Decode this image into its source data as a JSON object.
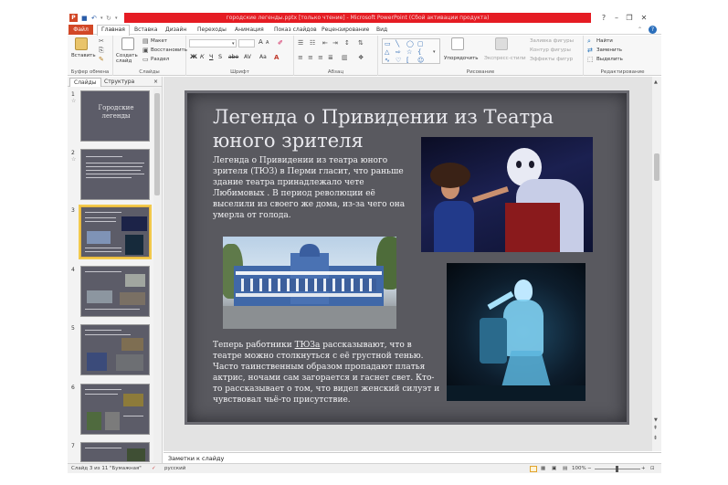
{
  "window": {
    "title": "городские легенды.pptx [только чтение] - Microsoft PowerPoint (Сбой активации продукта)",
    "app_letter": "P",
    "title_color": "#e51c23"
  },
  "ribbon_tabs": {
    "file": "Файл",
    "items": [
      "Главная",
      "Вставка",
      "Дизайн",
      "Переходы",
      "Анимация",
      "Показ слайдов",
      "Рецензирование",
      "Вид"
    ]
  },
  "ribbon": {
    "clipboard": {
      "paste": "Вставить",
      "label": "Буфер обмена"
    },
    "slides": {
      "create_slide": "Создать слайд",
      "layout": "Макет",
      "reset": "Восстановить",
      "section": "Раздел",
      "label": "Слайды"
    },
    "font": {
      "font_name": "",
      "font_size": "",
      "bold": "Ж",
      "italic": "К",
      "underline": "Ч",
      "strike": "S",
      "shadow": "abe",
      "spacing": "AV",
      "case": "Aa",
      "grow": "A",
      "shrink": "A",
      "label": "Шрифт"
    },
    "paragraph": {
      "label": "Абзац"
    },
    "drawing": {
      "arrange": "Упорядочить",
      "quick_styles": "Экспресс-стили",
      "fill": "Заливка фигуры",
      "outline": "Контур фигуры",
      "effects": "Эффекты фигур",
      "label": "Рисование"
    },
    "editing": {
      "find": "Найти",
      "replace": "Заменить",
      "select": "Выделить",
      "label": "Редактирование"
    }
  },
  "panel": {
    "tab_slides": "Слайды",
    "tab_outline": "Структура",
    "close": "×",
    "thumbnails": [
      {
        "num": "1",
        "star": "☆",
        "title": "Городские легенды"
      },
      {
        "num": "2",
        "star": "☆",
        "title": ""
      },
      {
        "num": "3",
        "star": "",
        "title": ""
      },
      {
        "num": "4",
        "star": "",
        "title": ""
      },
      {
        "num": "5",
        "star": "",
        "title": ""
      },
      {
        "num": "6",
        "star": "",
        "title": ""
      },
      {
        "num": "7",
        "star": "",
        "title": ""
      }
    ]
  },
  "slide": {
    "title": "Легенда о Привидении из Театра юного зрителя",
    "text1": "Легенда о Привидении из театра юного зрителя (ТЮЗ) в Перми гласит, что раньше здание театра принадлежало чете Любимовых . В период революции её выселили из своего же дома, из-за чего она умерла от голода.",
    "text2": "Теперь работники ТЮЗа рассказывают, что в театре можно столкнуться с её грустной тенью. Часто таинственным образом пропадают платья актрис, ночами сам загорается и гаснет свет. Кто-то рассказывает о том, что видел женский силуэт и чувствовал чьё-то присутствие.",
    "text2_underlined": "ТЮЗа",
    "images": {
      "theatre_stage": "theatre-performance-photo",
      "building": "theatre-building-photo",
      "ghost": "ghost-costume-photo"
    }
  },
  "notes_placeholder": "Заметки к слайду",
  "statusbar": {
    "slide_pos": "Слайд 3 из 11",
    "theme": "\"Бумажная\"",
    "language": "русский",
    "zoom": "100%"
  }
}
